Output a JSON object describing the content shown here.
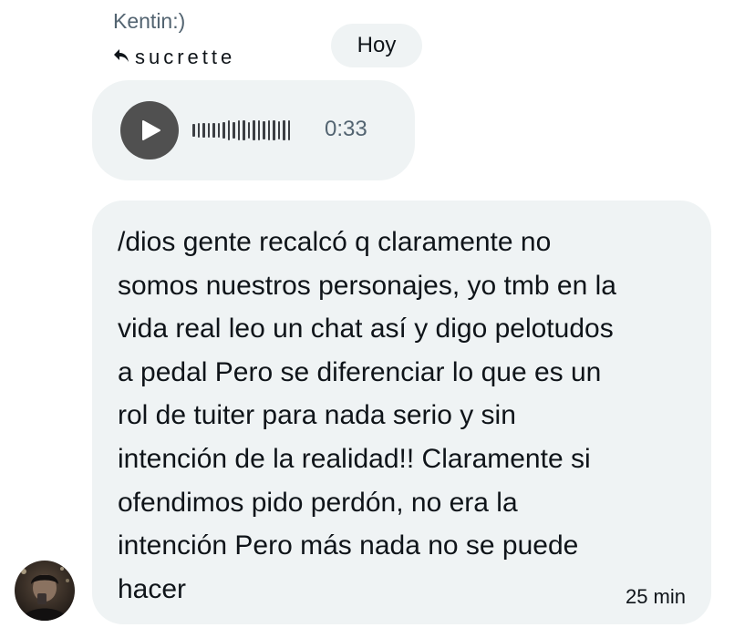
{
  "sender": {
    "name": "Kentin:)"
  },
  "reply": {
    "icon": "reply-arrow-icon",
    "to": "sucrette"
  },
  "date_separator": {
    "label": "Hoy"
  },
  "audio_message": {
    "duration": "0:33",
    "icon": "play-icon"
  },
  "text_message": {
    "lines": [
      "/dios gente recalcó q claramente no",
      "somos nuestros personajes, yo tmb en la",
      "vida real leo un chat así y digo pelotudos",
      "a pedal Pero se diferenciar lo que es un",
      "rol de tuiter para nada serio y sin",
      "intención de la realidad!! Claramente si",
      "ofendimos pido perdón, no era la",
      "intención Pero más nada no se puede",
      "hacer"
    ],
    "timestamp": "25 min"
  },
  "colors": {
    "bubble_bg": "#eff3f4",
    "text": "#0f1419",
    "secondary_text": "#536471",
    "play_button": "#505050"
  }
}
